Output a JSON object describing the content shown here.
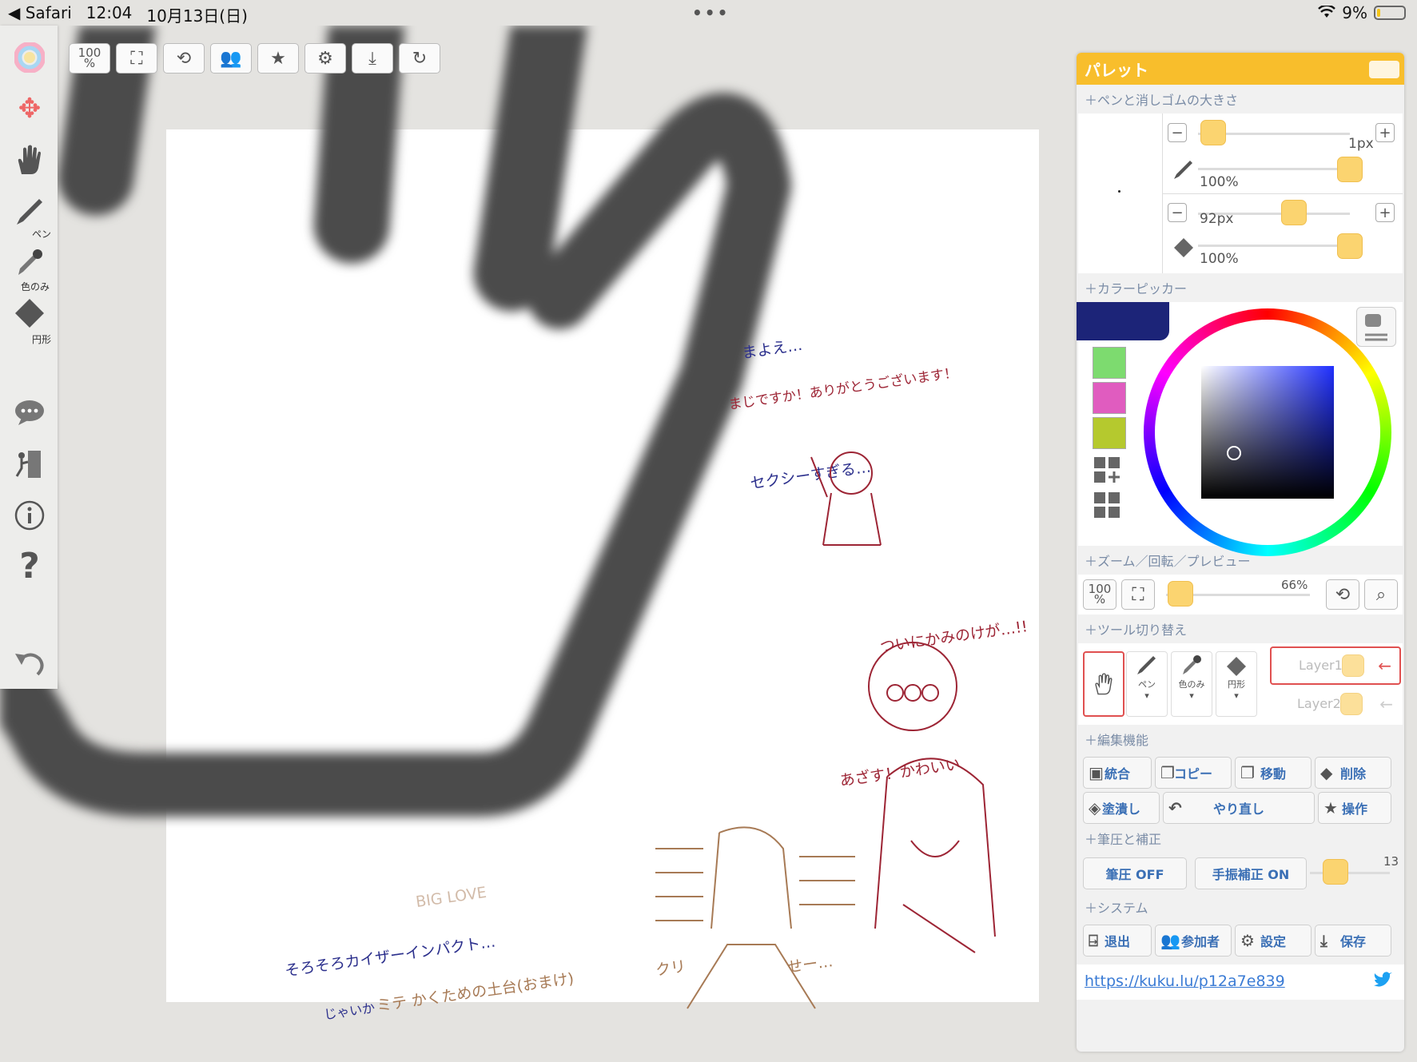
{
  "status_bar": {
    "back_label": "◀ Safari",
    "time": "12:04",
    "date": "10月13日(日)",
    "dots": "•••",
    "battery": "9%"
  },
  "left_toolbar": {
    "pen_label": "ペン",
    "eyedropper_label": "色のみ",
    "eraser_label": "円形"
  },
  "top_toolbar": {
    "zoom_100": "100",
    "zoom_pct": "%"
  },
  "canvas_texts": {
    "t1": "まよえ…",
    "t2": "まじですか！ありがとうございます！",
    "t3": "セクシーすぎる…",
    "t4": "ついにかみのけが…!!",
    "t5": "あざす！かわいい",
    "t6": "BIG LOVE",
    "t7": "そろそろカイザーインパクト…",
    "t8": "じゃいか",
    "t9": "ミテ かくための土台(おまけ)",
    "t10": "クリ",
    "t11": "せー…"
  },
  "palette": {
    "title": "パレット",
    "sections": {
      "pen_size": "＋ペンと消しゴムの大きさ",
      "color_picker": "＋カラーピッカー",
      "zoom": "＋ズーム／回転／プレビュー",
      "tool_switch": "＋ツール切り替え",
      "edit": "＋編集機能",
      "pressure": "＋筆圧と補正",
      "system": "＋システム"
    },
    "pen": {
      "size": "1px",
      "opacity": "100%",
      "size_level": 0.02,
      "opacity_level": 1.0
    },
    "eraser": {
      "size": "92px",
      "opacity": "100%",
      "size_level": 0.6,
      "opacity_level": 1.0
    },
    "current_color": "#1c2478",
    "swatches": [
      "#7ddb6f",
      "#e05cbf",
      "#b5c92e"
    ],
    "zoom": {
      "value": "66%",
      "label_100": "100",
      "label_pct": "%"
    },
    "tools": {
      "pen": "ペン",
      "eyedropper": "色のみ",
      "eraser": "円形"
    },
    "layers": [
      "Layer1",
      "Layer2"
    ],
    "edit_buttons": {
      "merge": "統合",
      "copy": "コピー",
      "move": "移動",
      "delete": "削除",
      "fill": "塗潰し",
      "redo": "やり直し",
      "operate": "操作"
    },
    "pressure": {
      "pen_pressure": "筆圧 OFF",
      "stabilizer": "手振補正 ON",
      "stabilizer_value": "13"
    },
    "system_buttons": {
      "exit": "退出",
      "participants": "参加者",
      "settings": "設定",
      "save": "保存"
    },
    "url": "https://kuku.lu/p12a7e839"
  }
}
